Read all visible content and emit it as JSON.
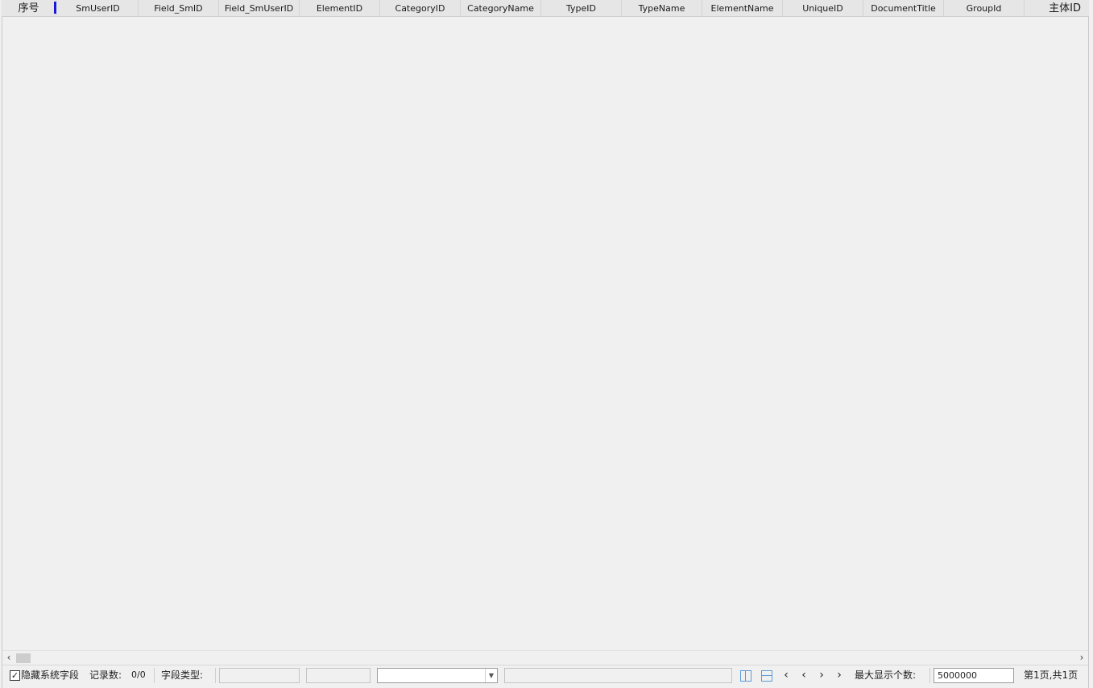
{
  "table": {
    "columns": {
      "rownum": "序号",
      "c1": "SmUserID",
      "c2": "Field_SmID",
      "c3": "Field_SmUserID",
      "c4": "ElementID",
      "c5": "CategoryID",
      "c6": "CategoryName",
      "c7": "TypeID",
      "c8": "TypeName",
      "c9": "ElementName",
      "c10": "UniqueID",
      "c11": "DocumentTitle",
      "c12": "GroupId",
      "c13": "主体ID"
    }
  },
  "statusbar": {
    "hide_system_fields": "隐藏系统字段",
    "hide_system_fields_checked": true,
    "record_count_label": "记录数:",
    "record_count_value": "0/0",
    "field_type_label": "字段类型:",
    "max_display_label": "最大显示个数:",
    "max_display_value": "5000000",
    "page_info": "第1页,共1页"
  }
}
